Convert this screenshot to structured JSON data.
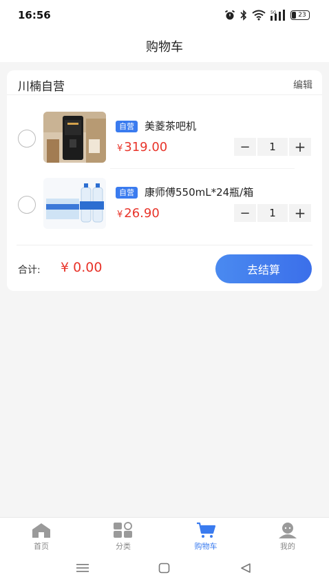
{
  "status": {
    "time": "16:56",
    "battery": "23"
  },
  "page": {
    "title": "购物车"
  },
  "store": {
    "name": "川楠自营",
    "edit_label": "编辑"
  },
  "items": [
    {
      "tag": "自营",
      "name": "美菱茶吧机",
      "currency": "¥",
      "price": "319.00",
      "qty": "1",
      "image_icon": "tea-bar-machine-image"
    },
    {
      "tag": "自营",
      "name": "康师傅550mL*24瓶/箱",
      "currency": "¥",
      "price": "26.90",
      "qty": "1",
      "image_icon": "water-bottles-image"
    }
  ],
  "qty_minus": "−",
  "qty_plus": "+",
  "summary": {
    "total_label": "合计:",
    "total_value": "¥ 0.00",
    "checkout_label": "去结算"
  },
  "tabs": [
    {
      "label": "首页",
      "icon": "home-icon",
      "active": false
    },
    {
      "label": "分类",
      "icon": "category-icon",
      "active": false
    },
    {
      "label": "购物车",
      "icon": "cart-icon",
      "active": true
    },
    {
      "label": "我的",
      "icon": "profile-icon",
      "active": false
    }
  ],
  "colors": {
    "accent": "#3a7bef",
    "price": "#e8342a",
    "tab_inactive": "#888888"
  }
}
